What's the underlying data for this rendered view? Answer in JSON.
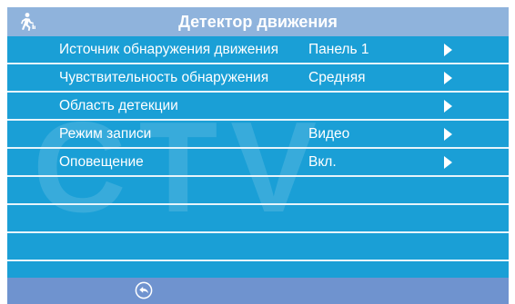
{
  "header": {
    "title": "Детектор движения",
    "icon": "running-person-icon"
  },
  "watermark": "CTV",
  "menu": [
    {
      "label": "Источник обнаружения движения",
      "value": "Панель 1",
      "has_arrow": true
    },
    {
      "label": "Чувствительность обнаружения",
      "value": "Средняя",
      "has_arrow": true
    },
    {
      "label": "Область детекции",
      "value": "",
      "has_arrow": true
    },
    {
      "label": "Режим записи",
      "value": "Видео",
      "has_arrow": true
    },
    {
      "label": "Оповещение",
      "value": "Вкл.",
      "has_arrow": true
    }
  ],
  "footer": {
    "back_icon": "back-arrow-icon"
  },
  "colors": {
    "background": "#1a9fd6",
    "header": "#8fb3dc",
    "footer": "#6f93cf",
    "divider": "#e6f4fb",
    "text": "#ffffff"
  }
}
